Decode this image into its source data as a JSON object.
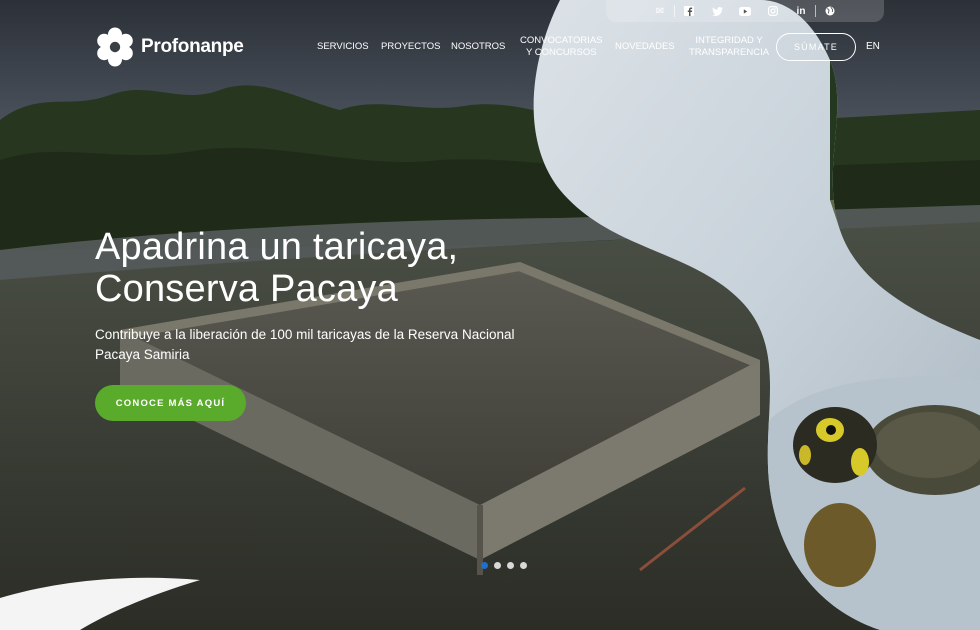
{
  "brand": {
    "name": "Profonanpe"
  },
  "topbar": {
    "icons": [
      "mail-icon",
      "facebook-icon",
      "twitter-icon",
      "youtube-icon",
      "instagram-icon",
      "linkedin-icon",
      "globe-icon"
    ]
  },
  "nav": {
    "items": [
      {
        "line1": "SERVICIOS",
        "line2": ""
      },
      {
        "line1": "PROYECTOS",
        "line2": ""
      },
      {
        "line1": "NOSOTROS",
        "line2": ""
      },
      {
        "line1": "CONVOCATORIAS",
        "line2": "Y CONCURSOS"
      },
      {
        "line1": "NOVEDADES",
        "line2": ""
      },
      {
        "line1": "INTEGRIDAD Y",
        "line2": "TRANSPARENCIA"
      }
    ],
    "cta": "SÚMATE",
    "lang": "EN"
  },
  "hero": {
    "title_line1": "Apadrina un taricaya,",
    "title_line2": "Conserva Pacaya",
    "subtitle": "Contribuye a la liberación de 100 mil taricayas de la Reserva Nacional Pacaya Samiria",
    "button": "CONOCE MÁS AQUÍ"
  },
  "slider": {
    "total": 4,
    "active": 1
  },
  "colors": {
    "accent_green": "#5aab2c",
    "active_dot": "#1e6fd0",
    "text": "#ffffff"
  }
}
